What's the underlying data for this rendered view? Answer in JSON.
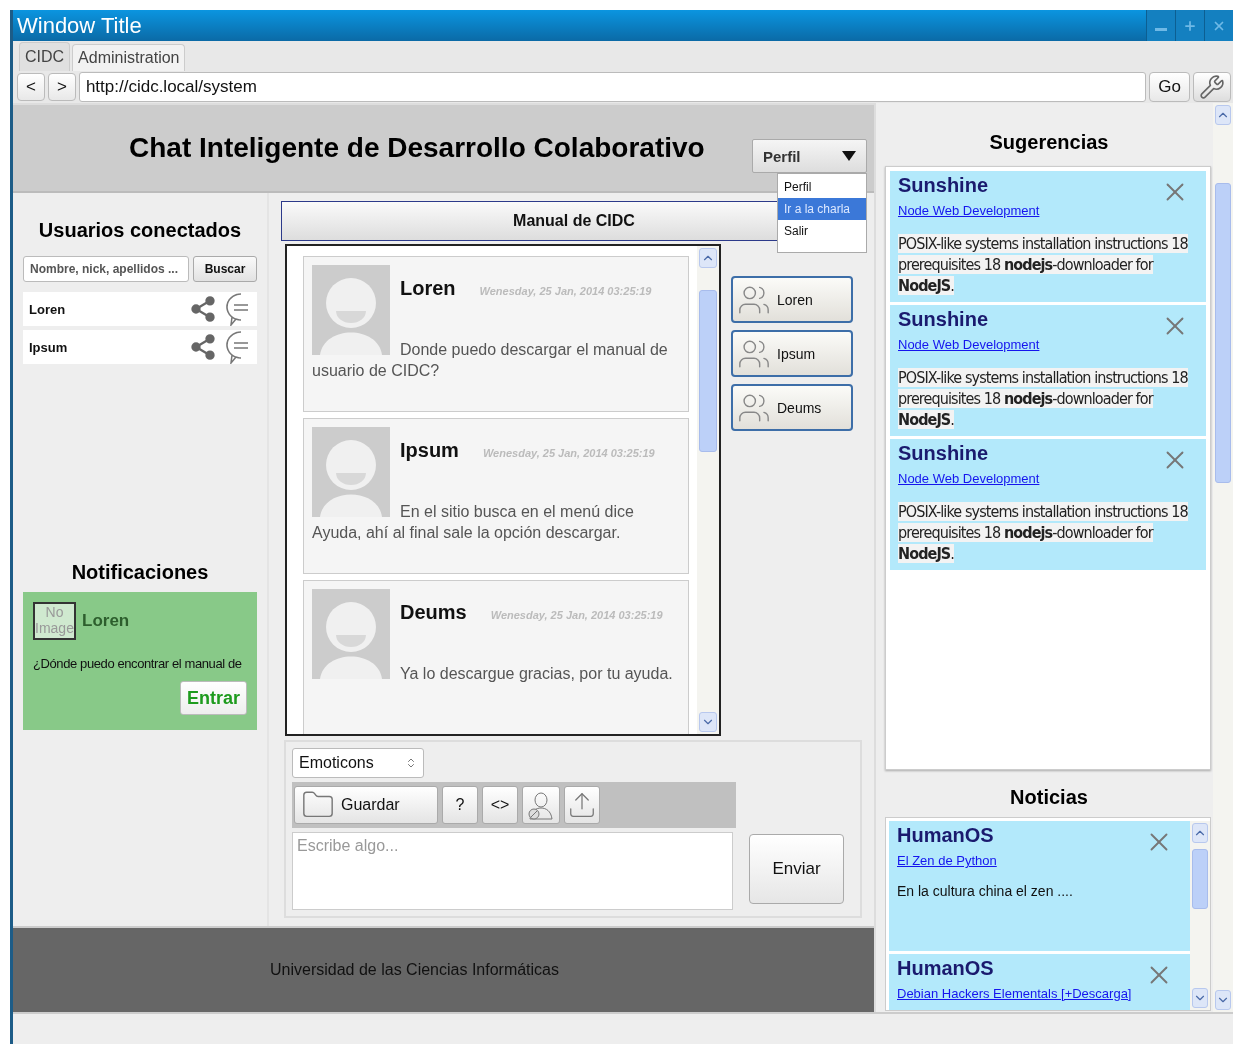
{
  "window": {
    "title": "Window Title"
  },
  "browser": {
    "tabs": [
      {
        "label": "CIDC",
        "selected": true
      },
      {
        "label": "Administration",
        "selected": false
      }
    ],
    "back": "<",
    "forward": ">",
    "url": "http://cidc.local/system",
    "go": "Go"
  },
  "header": {
    "title": "Chat Inteligente de Desarrollo Colaborativo",
    "profile_menu": {
      "label": "Perfil",
      "expanded": true,
      "items": [
        {
          "label": "Perfil",
          "selected": false
        },
        {
          "label": "Ir a la charla",
          "selected": true
        },
        {
          "label": "Salir",
          "selected": false
        }
      ]
    }
  },
  "users": {
    "heading": "Usuarios conectados",
    "search": {
      "placeholder": "Nombre, nick, apellidos ...",
      "button": "Buscar"
    },
    "items": [
      {
        "name": "Loren"
      },
      {
        "name": "Ipsum"
      }
    ]
  },
  "notifications": {
    "heading": "Notificaciones",
    "items": [
      {
        "image_placeholder": "No Image",
        "sender": "Loren",
        "message": "¿Dónde puedo encontrar el manual de",
        "button": "Entrar"
      }
    ]
  },
  "chat": {
    "title": "Manual de CIDC",
    "messages": [
      {
        "author": "Loren",
        "time": "Wenesday, 25 Jan, 2014 03:25:19",
        "text": "Donde puedo descargar el manual de usuario de CIDC?"
      },
      {
        "author": "Ipsum",
        "time": "Wenesday, 25 Jan, 2014 03:25:19",
        "text": "En el sitio busca en el menú dice Ayuda, ahí al final sale la opción descargar."
      },
      {
        "author": "Deums",
        "time": "Wenesday, 25 Jan, 2014 03:25:19",
        "text": "Ya lo descargue gracias, por tu ayuda."
      }
    ],
    "participants": [
      "Loren",
      "Ipsum",
      "Deums"
    ]
  },
  "composer": {
    "emoticons": "Emoticons",
    "save_button": "Guardar",
    "text_buttons": [
      "?",
      "<>"
    ],
    "placeholder": "Escribe algo...",
    "send": "Enviar"
  },
  "footer": {
    "text": "Universidad de las Ciencias Informáticas"
  },
  "suggestions": {
    "heading": "Sugerencias",
    "items": [
      {
        "title": "Sunshine",
        "link": "Node Web Development",
        "text": "POSIX-like systems installation instructions 18 prerequisites 18 **nodejs**-downloader for **NodeJS**."
      },
      {
        "title": "Sunshine",
        "link": "Node Web Development",
        "text": "POSIX-like systems installation instructions 18 prerequisites 18 **nodejs**-downloader for **NodeJS**."
      },
      {
        "title": "Sunshine",
        "link": "Node Web Development",
        "text": "POSIX-like systems installation instructions 18 prerequisites 18 **nodejs**-downloader for **NodeJS**."
      }
    ]
  },
  "news": {
    "heading": "Noticias",
    "items": [
      {
        "title": "HumanOS",
        "link": "El Zen de Python",
        "text": "En la cultura china el zen ...."
      },
      {
        "title": "HumanOS",
        "link": "Debian Hackers Elementals [+Descarga]"
      }
    ]
  }
}
